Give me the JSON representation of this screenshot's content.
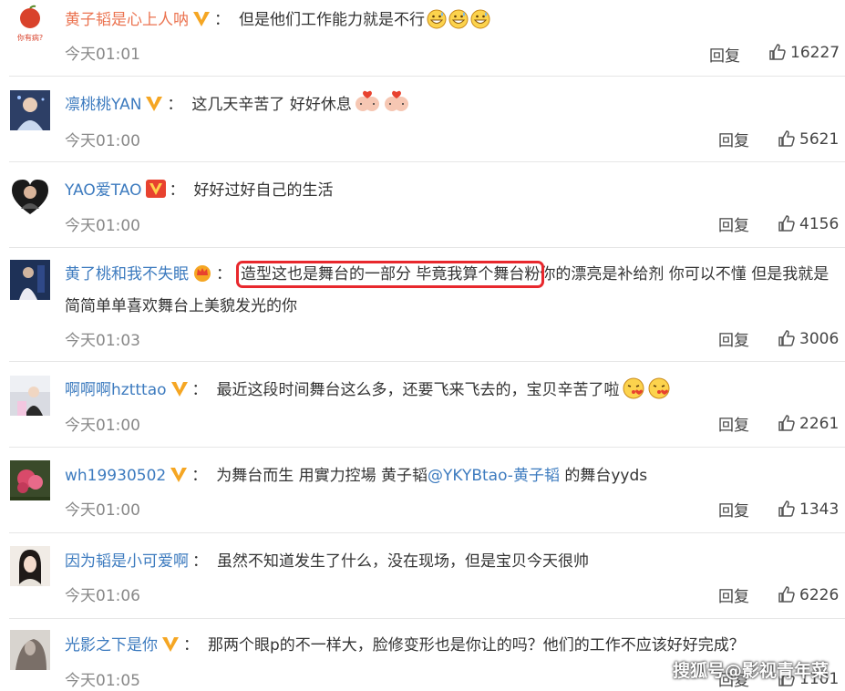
{
  "colors": {
    "username_orange": "#eb7350",
    "username_blue": "#3d7bbf",
    "highlight_border": "#e8282d",
    "vip_orange": "#f5a623",
    "vip_red": "#e8422f"
  },
  "comments": [
    {
      "username": "黄子韬是心上人呐",
      "badge": "vip-v-icon",
      "text": "但是他们工作能力就是不行",
      "emojis": [
        "grin-sweat-emoji",
        "grin-sweat-emoji",
        "grin-sweat-emoji"
      ],
      "time": "今天01:01",
      "reply_label": "回复",
      "likes": "16227",
      "avatar_text": "你有病?"
    },
    {
      "username": "凛桃桃YAN",
      "badge": "vip-v-icon",
      "text": "这几天辛苦了 好好休息",
      "emojis": [
        "pig-heart-emoji",
        "pig-heart-emoji"
      ],
      "time": "今天01:00",
      "reply_label": "回复",
      "likes": "5621"
    },
    {
      "username": "YAO爱TAO",
      "badge": "vip-v-red-icon",
      "text": "好好过好自己的生活",
      "emojis": [],
      "time": "今天01:00",
      "reply_label": "回复",
      "likes": "4156"
    },
    {
      "username": "黄了桃和我不失眠",
      "badge": "crown-icon",
      "text_highlight": "造型这也是舞台的一部分 毕竟我算个舞台粉",
      "text": "你的漂亮是补给剂 你可以不懂 但是我就是简简单单喜欢舞台上美貌发光的你",
      "emojis": [],
      "time": "今天01:03",
      "reply_label": "回复",
      "likes": "3006"
    },
    {
      "username": "啊啊啊hztttao",
      "badge": "vip-v-icon",
      "text": "最近这段时间舞台这么多，还要飞来飞去的，宝贝辛苦了啦",
      "emojis": [
        "kiss-emoji",
        "kiss-emoji"
      ],
      "time": "今天01:00",
      "reply_label": "回复",
      "likes": "2261"
    },
    {
      "username": "wh19930502",
      "badge": "vip-v-icon",
      "text": "为舞台而生 用實力控場 黄子韬",
      "mention": "@YKYBtao-黄子韬",
      "text_after": " 的舞台yyds",
      "emojis": [],
      "time": "今天01:00",
      "reply_label": "回复",
      "likes": "1343"
    },
    {
      "username": "因为韬是小可爱啊",
      "badge": "",
      "text": "虽然不知道发生了什么，没在现场，但是宝贝今天很帅",
      "emojis": [],
      "time": "今天01:06",
      "reply_label": "回复",
      "likes": "6226"
    },
    {
      "username": "光影之下是你",
      "badge": "vip-v-icon",
      "text": "那两个眼p的不一样大，脸修变形也是你让的吗？他们的工作不应该好好完成？",
      "emojis": [],
      "time": "今天01:05",
      "reply_label": "回复",
      "likes": "1101"
    }
  ],
  "watermark": "搜狐号@影视青年菜"
}
